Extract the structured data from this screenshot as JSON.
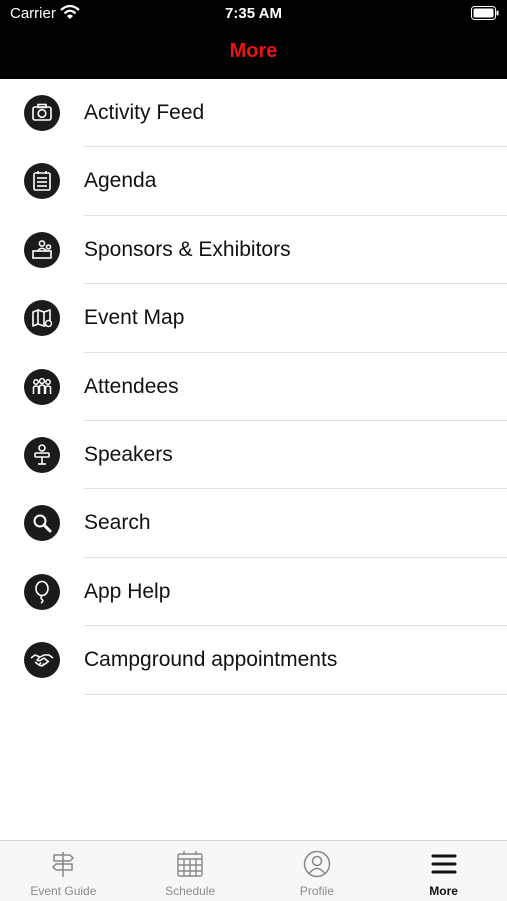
{
  "status_bar": {
    "carrier": "Carrier",
    "time": "7:35 AM"
  },
  "header": {
    "title": "More",
    "title_color": "#e8141a"
  },
  "menu": {
    "items": [
      {
        "label": "Activity Feed",
        "icon": "camera-icon"
      },
      {
        "label": "Agenda",
        "icon": "agenda-icon"
      },
      {
        "label": "Sponsors & Exhibitors",
        "icon": "sponsors-icon"
      },
      {
        "label": "Event Map",
        "icon": "map-icon"
      },
      {
        "label": "Attendees",
        "icon": "attendees-icon"
      },
      {
        "label": "Speakers",
        "icon": "speaker-icon"
      },
      {
        "label": "Search",
        "icon": "search-icon"
      },
      {
        "label": "App Help",
        "icon": "balloon-icon"
      },
      {
        "label": "Campground appointments",
        "icon": "handshake-icon"
      }
    ]
  },
  "tab_bar": {
    "tabs": [
      {
        "label": "Event Guide",
        "icon": "signpost-icon",
        "active": false
      },
      {
        "label": "Schedule",
        "icon": "calendar-icon",
        "active": false
      },
      {
        "label": "Profile",
        "icon": "profile-icon",
        "active": false
      },
      {
        "label": "More",
        "icon": "hamburger-icon",
        "active": true
      }
    ]
  }
}
